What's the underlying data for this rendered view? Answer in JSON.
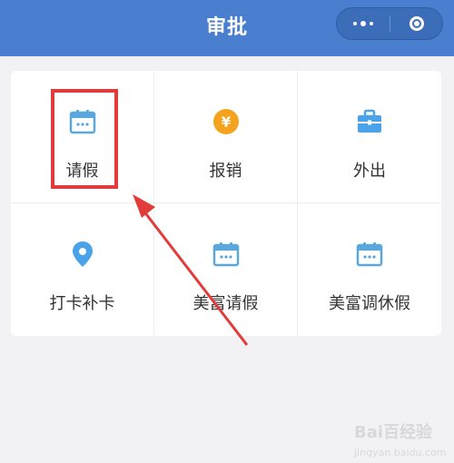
{
  "header": {
    "title": "审批",
    "bg_color": "#4a7fd0",
    "more_icon": "more-dots-icon",
    "close_icon": "target-circle-icon"
  },
  "apps": [
    {
      "label": "请假",
      "icon": "calendar-icon",
      "color": "#5aa7e0"
    },
    {
      "label": "报销",
      "icon": "yen-coin-icon",
      "color": "#f4a31f"
    },
    {
      "label": "外出",
      "icon": "briefcase-icon",
      "color": "#4aa3e8"
    },
    {
      "label": "打卡补卡",
      "icon": "location-pin-icon",
      "color": "#4aa3e8"
    },
    {
      "label": "美富请假",
      "icon": "calendar-icon",
      "color": "#5aa7e0"
    },
    {
      "label": "美富调休假",
      "icon": "calendar-icon",
      "color": "#5aa7e0"
    }
  ],
  "coin_symbol": "¥",
  "annotation": {
    "color": "#e23b3b",
    "highlighted_item": "请假"
  },
  "watermark": {
    "line1": "Bai百经验",
    "line2": "jingyan.baidu.com"
  }
}
